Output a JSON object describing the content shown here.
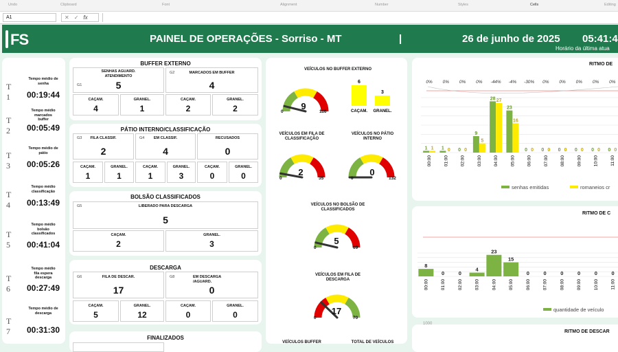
{
  "ribbon": {
    "groups": [
      "Undo",
      "Clipboard",
      "Font",
      "Alignment",
      "Number",
      "Styles",
      "Cells",
      "Editing"
    ]
  },
  "formula_bar": {
    "name_box": "A1",
    "cancel": "✕",
    "enter": "✓",
    "fx": "fx"
  },
  "header": {
    "logo": "FS",
    "title": "PAINEL DE OPERAÇÕES - Sorriso - MT",
    "separator": "|",
    "date": "26 de junho de 2025",
    "time": "05:41:44",
    "time_caption": "Horário da última atua",
    "bg_color": "#1f7a4d"
  },
  "times": [
    {
      "label": "T 1",
      "caption": [
        "Tempo médio de",
        "senha"
      ],
      "value": "00:19:44"
    },
    {
      "label": "T 2",
      "caption": [
        "Tempo médio",
        "marcados",
        "buffer"
      ],
      "value": "00:05:49"
    },
    {
      "label": "T 3",
      "caption": [
        "Tempo médio de",
        "pátio"
      ],
      "value": "00:05:26"
    },
    {
      "label": "T 4",
      "caption": [
        "Tempo médio",
        "classificação"
      ],
      "value": "00:13:49"
    },
    {
      "label": "T 5",
      "caption": [
        "Tempo médio",
        "bolsão",
        "classificados"
      ],
      "value": "00:41:04"
    },
    {
      "label": "T 6",
      "caption": [
        "Tempo médio",
        "fila espera",
        "descarga"
      ],
      "value": "00:27:49"
    },
    {
      "label": "T 7",
      "caption": [
        "Tempo médio de",
        "descarga"
      ],
      "value": "00:31:30"
    }
  ],
  "buffer_externo": {
    "title": "BUFFER EXTERNO",
    "g1": {
      "code": "G1",
      "caption": [
        "SENHAS AGUARD.",
        "ATENDIMENTO"
      ],
      "value": "5"
    },
    "g2": {
      "code": "G2",
      "caption": [
        "MARCADOS EM BUFFER"
      ],
      "value": "4"
    },
    "sub": [
      {
        "caption": "CAÇAM.",
        "value": "4"
      },
      {
        "caption": "GRANEL.",
        "value": "1"
      },
      {
        "caption": "CAÇAM.",
        "value": "2"
      },
      {
        "caption": "GRANEL.",
        "value": "2"
      }
    ]
  },
  "patio": {
    "title": "PÁTIO INTERNO/CLASSIFICAÇÃO",
    "g3": {
      "code": "G3",
      "caption": "FILA CLASSIF.",
      "value": "2"
    },
    "g4": {
      "code": "G4",
      "caption": "EM CLASSIF.",
      "value": "4"
    },
    "recusados": {
      "caption": "RECUSADOS",
      "value": "0"
    },
    "sub": [
      {
        "caption": "CAÇAM.",
        "value": "1"
      },
      {
        "caption": "GRANEL.",
        "value": "1"
      },
      {
        "caption": "CAÇAM.",
        "value": "1"
      },
      {
        "caption": "GRANEL.",
        "value": "3"
      },
      {
        "caption": "CAÇAM.",
        "value": "0"
      },
      {
        "caption": "GRANEL.",
        "value": "0"
      }
    ]
  },
  "bolsao": {
    "title": "BOLSÃO CLASSIFICADOS",
    "g5": {
      "code": "G5",
      "caption": "LIBERADO PARA DESCARGA",
      "value": "5"
    },
    "sub": [
      {
        "caption": "CAÇAM.",
        "value": "2"
      },
      {
        "caption": "GRANEL.",
        "value": "3"
      }
    ]
  },
  "descarga": {
    "title": "DESCARGA",
    "g6": {
      "code": "G6",
      "caption": "FILA DE DESCAR.",
      "value": "17"
    },
    "g8": {
      "code": "G8",
      "caption": [
        "EM DESCARGA",
        "/AGUARD."
      ],
      "value": "0"
    },
    "sub": [
      {
        "caption": "CAÇAM.",
        "value": "5"
      },
      {
        "caption": "GRANEL.",
        "value": "12"
      },
      {
        "caption": "CAÇAM.",
        "value": "0"
      },
      {
        "caption": "GRANEL.",
        "value": "0"
      }
    ]
  },
  "finalizados": {
    "title": "FINALIZADOS"
  },
  "gauges": [
    {
      "id": "buffer",
      "title": [
        "VEÍCULOS NO BUFFER EXTERNO"
      ],
      "value": 9,
      "min": 0,
      "max": 116
    },
    {
      "id": "fila-classif",
      "title": [
        "VEÍCULOS EM FILA DE",
        "CLASSIFICAÇÃO"
      ],
      "value": 2,
      "min": 0,
      "max": 35
    },
    {
      "id": "patio",
      "title": [
        "VEÍCULOS NO PÁTIO",
        "INTERNO"
      ],
      "value": 0,
      "min": 0,
      "max": 132
    },
    {
      "id": "bolsao",
      "title": [
        "VEÍCULOS NO BOLSÃO DE",
        "CLASSIFICADOS"
      ],
      "value": 5,
      "min": 0,
      "max": 69
    },
    {
      "id": "fila-descarga",
      "title": [
        "VEÍCULOS EM FILA DE",
        "DESCARGA"
      ],
      "value": 17,
      "min": 0,
      "max": 70
    }
  ],
  "gauge_texts": {
    "buffer_min": "0",
    "buffer_val": "9",
    "buffer_max": "116",
    "fc_min": "0",
    "fc_val": "2",
    "fc_max": "35",
    "pat_min": "0",
    "pat_val": "0",
    "pat_max": "132",
    "bol_min": "0",
    "bol_val": "5",
    "bol_max": "69",
    "fd_min": "0",
    "fd_val": "17",
    "fd_max": "70"
  },
  "bottom_titles": {
    "left": "VEÍCULOS BUFFER",
    "right": "TOTAL DE VEÍCULOS"
  },
  "chart_data": [
    {
      "type": "bar",
      "title": "",
      "categories": [
        "CAÇAM.",
        "GRANEL."
      ],
      "values": [
        6,
        3
      ],
      "colors": [
        "#ffff00",
        "#ffff00"
      ]
    },
    {
      "type": "bar",
      "title": "RITMO DE",
      "categories": [
        "00:00",
        "01:00",
        "02:00",
        "03:00",
        "04:00",
        "05:00",
        "06:00",
        "07:00",
        "08:00",
        "09:00",
        "10:00",
        "11:00"
      ],
      "series": [
        {
          "name": "senhas emitidas",
          "color": "#7cb342",
          "values": [
            1,
            1,
            0,
            9,
            28,
            23,
            0,
            0,
            0,
            0,
            0,
            0
          ]
        },
        {
          "name": "romaneios cr",
          "color": "#ffeb00",
          "values": [
            1,
            0,
            0,
            5,
            27,
            16,
            0,
            0,
            0,
            0,
            0,
            0
          ]
        }
      ],
      "annotations": [
        "0%",
        "0%",
        "0%",
        "0%",
        "-44%",
        "-4%",
        "-30%",
        "0%",
        "0%",
        "0%",
        "0%",
        "0%"
      ],
      "ylim": [
        0,
        30
      ]
    },
    {
      "type": "bar",
      "title": "RITMO DE C",
      "categories": [
        "00:00",
        "01:00",
        "02:00",
        "03:00",
        "04:00",
        "05:00",
        "06:00",
        "07:00",
        "08:00",
        "09:00",
        "10:00",
        "11:00"
      ],
      "series": [
        {
          "name": "quantidade de veículo",
          "color": "#7cb342",
          "values": [
            8,
            0,
            0,
            4,
            23,
            15,
            0,
            0,
            0,
            0,
            0,
            0
          ]
        }
      ],
      "ylim": [
        0,
        25
      ]
    },
    {
      "type": "bar",
      "title": "RITMO DE DESCAR",
      "ylabel_tick": "1000"
    }
  ]
}
